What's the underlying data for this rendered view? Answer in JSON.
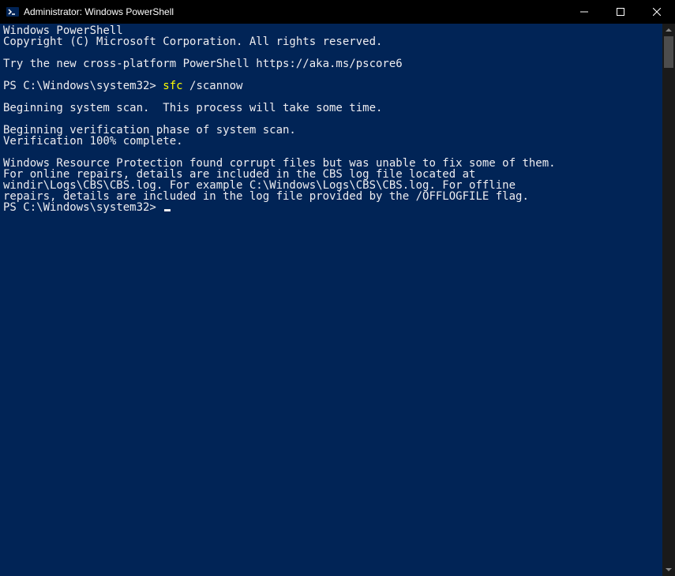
{
  "window": {
    "title": "Administrator: Windows PowerShell"
  },
  "terminal": {
    "lines": [
      {
        "type": "text",
        "text": "Windows PowerShell"
      },
      {
        "type": "text",
        "text": "Copyright (C) Microsoft Corporation. All rights reserved."
      },
      {
        "type": "blank"
      },
      {
        "type": "text",
        "text": "Try the new cross-platform PowerShell https://aka.ms/pscore6"
      },
      {
        "type": "blank"
      },
      {
        "type": "prompt",
        "prompt": "PS C:\\Windows\\system32> ",
        "command": "sfc ",
        "arg": "/scannow"
      },
      {
        "type": "blank"
      },
      {
        "type": "text",
        "text": "Beginning system scan.  This process will take some time."
      },
      {
        "type": "blank"
      },
      {
        "type": "text",
        "text": "Beginning verification phase of system scan."
      },
      {
        "type": "text",
        "text": "Verification 100% complete."
      },
      {
        "type": "blank"
      },
      {
        "type": "text",
        "text": "Windows Resource Protection found corrupt files but was unable to fix some of them."
      },
      {
        "type": "text",
        "text": "For online repairs, details are included in the CBS log file located at"
      },
      {
        "type": "text",
        "text": "windir\\Logs\\CBS\\CBS.log. For example C:\\Windows\\Logs\\CBS\\CBS.log. For offline"
      },
      {
        "type": "text",
        "text": "repairs, details are included in the log file provided by the /OFFLOGFILE flag."
      },
      {
        "type": "prompt-cursor",
        "prompt": "PS C:\\Windows\\system32> "
      }
    ]
  }
}
